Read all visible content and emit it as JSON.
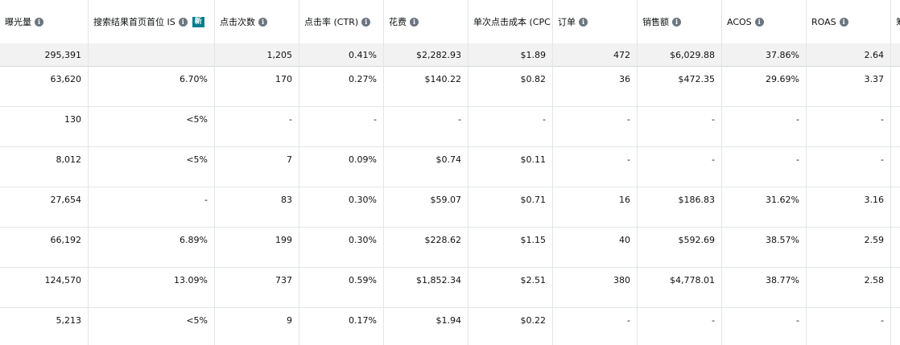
{
  "columns": [
    {
      "key": "impressions",
      "label": "曝光量",
      "info_icon": "info-icon"
    },
    {
      "key": "tos_is",
      "label": "搜索结果首页首位 IS",
      "info_icon": "info-icon",
      "badge": "新"
    },
    {
      "key": "clicks",
      "label": "点击次数",
      "info_icon": "info-icon"
    },
    {
      "key": "ctr",
      "label": "点击率 (CTR)",
      "info_icon": "info-icon"
    },
    {
      "key": "spend",
      "label": "花费",
      "info_icon": "info-icon"
    },
    {
      "key": "cpc",
      "label": "单次点击成本 (CPC",
      "info_icon": "info-icon"
    },
    {
      "key": "orders",
      "label": "订单",
      "info_icon": "info-icon"
    },
    {
      "key": "sales",
      "label": "销售额",
      "info_icon": "info-icon"
    },
    {
      "key": "acos",
      "label": "ACOS",
      "info_icon": "info-icon"
    },
    {
      "key": "roas",
      "label": "ROAS",
      "info_icon": "info-icon"
    },
    {
      "key": "extra",
      "label": "筹"
    }
  ],
  "totals": [
    "295,391",
    "",
    "1,205",
    "0.41%",
    "$2,282.93",
    "$1.89",
    "472",
    "$6,029.88",
    "37.86%",
    "2.64"
  ],
  "rows": [
    [
      "63,620",
      "6.70%",
      "170",
      "0.27%",
      "$140.22",
      "$0.82",
      "36",
      "$472.35",
      "29.69%",
      "3.37"
    ],
    [
      "130",
      "<5%",
      "-",
      "-",
      "-",
      "-",
      "-",
      "-",
      "-",
      "-"
    ],
    [
      "8,012",
      "<5%",
      "7",
      "0.09%",
      "$0.74",
      "$0.11",
      "-",
      "-",
      "-",
      "-"
    ],
    [
      "27,654",
      "-",
      "83",
      "0.30%",
      "$59.07",
      "$0.71",
      "16",
      "$186.83",
      "31.62%",
      "3.16"
    ],
    [
      "66,192",
      "6.89%",
      "199",
      "0.30%",
      "$228.62",
      "$1.15",
      "40",
      "$592.69",
      "38.57%",
      "2.59"
    ],
    [
      "124,570",
      "13.09%",
      "737",
      "0.59%",
      "$1,852.34",
      "$2.51",
      "380",
      "$4,778.01",
      "38.77%",
      "2.58"
    ],
    [
      "5,213",
      "<5%",
      "9",
      "0.17%",
      "$1.94",
      "$0.22",
      "-",
      "-",
      "-",
      "-"
    ]
  ],
  "row_edge_marks": [
    "",
    "",
    "",
    "-",
    "",
    "",
    ""
  ],
  "info_glyph": "i",
  "colors": {
    "badge": "#067d8c",
    "total_row_bg": "#f2f2f2",
    "icon": "#6b7680"
  }
}
